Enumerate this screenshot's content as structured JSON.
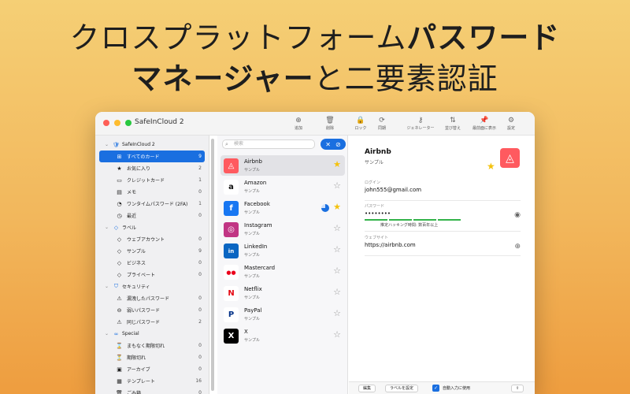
{
  "headline": {
    "line1_normal": "クロスプラットフォーム",
    "line1_bold": "パスワード",
    "line2_bold": "マネージャー",
    "line2_normal": "と二要素認証"
  },
  "window": {
    "title": "SafeInCloud 2",
    "toolbar": [
      {
        "icon": "plus-circle-icon",
        "glyph": "⊕",
        "label": "追加"
      },
      {
        "icon": "trash-icon",
        "glyph": "🗑",
        "label": "削除"
      },
      {
        "icon": "lock-icon",
        "glyph": "🔒",
        "label": "ロック"
      },
      {
        "icon": "sync-icon",
        "glyph": "⟳",
        "label": "同期"
      },
      {
        "icon": "key-icon",
        "glyph": "⚷",
        "label": "ジェネレーター"
      },
      {
        "icon": "sort-icon",
        "glyph": "⇅",
        "label": "並び替え"
      },
      {
        "icon": "pin-icon",
        "glyph": "📌",
        "label": "最前面に表示"
      },
      {
        "icon": "gear-icon",
        "glyph": "⚙",
        "label": "設定"
      }
    ]
  },
  "sidebar": {
    "groups": [
      {
        "label": "SafeInCloud 2",
        "icon": "shield-icon",
        "glyph": "🛡",
        "items": [
          {
            "label": "すべてのカード",
            "icon": "grid-icon",
            "glyph": "⊞",
            "count": "9",
            "selected": true
          },
          {
            "label": "お気に入り",
            "icon": "star-icon",
            "glyph": "★",
            "count": "2"
          },
          {
            "label": "クレジットカード",
            "icon": "credit-card-icon",
            "glyph": "▭",
            "count": "1"
          },
          {
            "label": "メモ",
            "icon": "note-icon",
            "glyph": "▤",
            "count": "0"
          },
          {
            "label": "ワンタイムパスワード (2FA)",
            "icon": "otp-icon",
            "glyph": "◔",
            "count": "1"
          },
          {
            "label": "最近",
            "icon": "clock-icon",
            "glyph": "◷",
            "count": "0"
          }
        ]
      },
      {
        "label": "ラベル",
        "icon": "tag-icon",
        "glyph": "◇",
        "items": [
          {
            "label": "ウェブアカウント",
            "icon": "tag-icon",
            "glyph": "◇",
            "count": "0"
          },
          {
            "label": "サンプル",
            "icon": "tag-icon",
            "glyph": "◇",
            "count": "9"
          },
          {
            "label": "ビジネス",
            "icon": "tag-icon",
            "glyph": "◇",
            "count": "0"
          },
          {
            "label": "プライベート",
            "icon": "tag-icon",
            "glyph": "◇",
            "count": "0"
          }
        ]
      },
      {
        "label": "セキュリティ",
        "icon": "shield-icon",
        "glyph": "⛉",
        "items": [
          {
            "label": "漏洩したパスワード",
            "icon": "warning-icon",
            "glyph": "⚠",
            "count": "0"
          },
          {
            "label": "弱いパスワード",
            "icon": "weak-icon",
            "glyph": "⊖",
            "count": "0"
          },
          {
            "label": "同じパスワード",
            "icon": "warning-icon",
            "glyph": "⚠",
            "count": "2"
          }
        ]
      },
      {
        "label": "Special",
        "icon": "special-icon",
        "glyph": "∞",
        "items": [
          {
            "label": "まもなく期限切れ",
            "icon": "hourglass-icon",
            "glyph": "⌛",
            "count": "0"
          },
          {
            "label": "期限切れ",
            "icon": "hourglass-icon",
            "glyph": "⏳",
            "count": "0"
          },
          {
            "label": "アーカイブ",
            "icon": "archive-icon",
            "glyph": "▣",
            "count": "0"
          },
          {
            "label": "テンプレート",
            "icon": "template-icon",
            "glyph": "▦",
            "count": "16"
          },
          {
            "label": "ごみ箱",
            "icon": "trash-icon",
            "glyph": "🗑",
            "count": "0"
          }
        ]
      }
    ]
  },
  "list": {
    "search_placeholder": "検索",
    "items": [
      {
        "name": "Airbnb",
        "sub": "サンプル",
        "logo_letter": "◬",
        "logo_color": "#ff5a5f",
        "logo_text_color": "#ffffff",
        "starred": true,
        "selected": true
      },
      {
        "name": "Amazon",
        "sub": "サンプル",
        "logo_letter": "a",
        "logo_color": "#ffffff",
        "logo_text_color": "#111111",
        "starred": false
      },
      {
        "name": "Facebook",
        "sub": "サンプル",
        "logo_letter": "f",
        "logo_color": "#1877f2",
        "logo_text_color": "#ffffff",
        "starred": true,
        "otp": true
      },
      {
        "name": "Instagram",
        "sub": "サンプル",
        "logo_letter": "◎",
        "logo_color": "#c13584",
        "logo_text_color": "#ffffff",
        "starred": false
      },
      {
        "name": "LinkedIn",
        "sub": "サンプル",
        "logo_letter": "in",
        "logo_color": "#0a66c2",
        "logo_text_color": "#ffffff",
        "starred": false
      },
      {
        "name": "Mastercard",
        "sub": "サンプル",
        "logo_letter": "●●",
        "logo_color": "#ffffff",
        "logo_text_color": "#eb001b",
        "starred": false
      },
      {
        "name": "Netflix",
        "sub": "サンプル",
        "logo_letter": "N",
        "logo_color": "#ffffff",
        "logo_text_color": "#e50914",
        "starred": false
      },
      {
        "name": "PayPal",
        "sub": "サンプル",
        "logo_letter": "P",
        "logo_color": "#ffffff",
        "logo_text_color": "#003087",
        "starred": false
      },
      {
        "name": "X",
        "sub": "サンプル",
        "logo_letter": "X",
        "logo_color": "#000000",
        "logo_text_color": "#ffffff",
        "starred": false
      }
    ]
  },
  "detail": {
    "title": "Airbnb",
    "subtitle": "サンプル",
    "login_label": "ログイン",
    "login_value": "john555@gmail.com",
    "password_label": "パスワード",
    "password_value": "••••••••",
    "hack_time": "推定ハッキング時間: 数百年以上",
    "website_label": "ウェブサイト",
    "website_value": "https://airbnb.com",
    "edit_button": "編集",
    "label_button": "ラベルを設定",
    "autofill_label": "自動入力に使用"
  }
}
